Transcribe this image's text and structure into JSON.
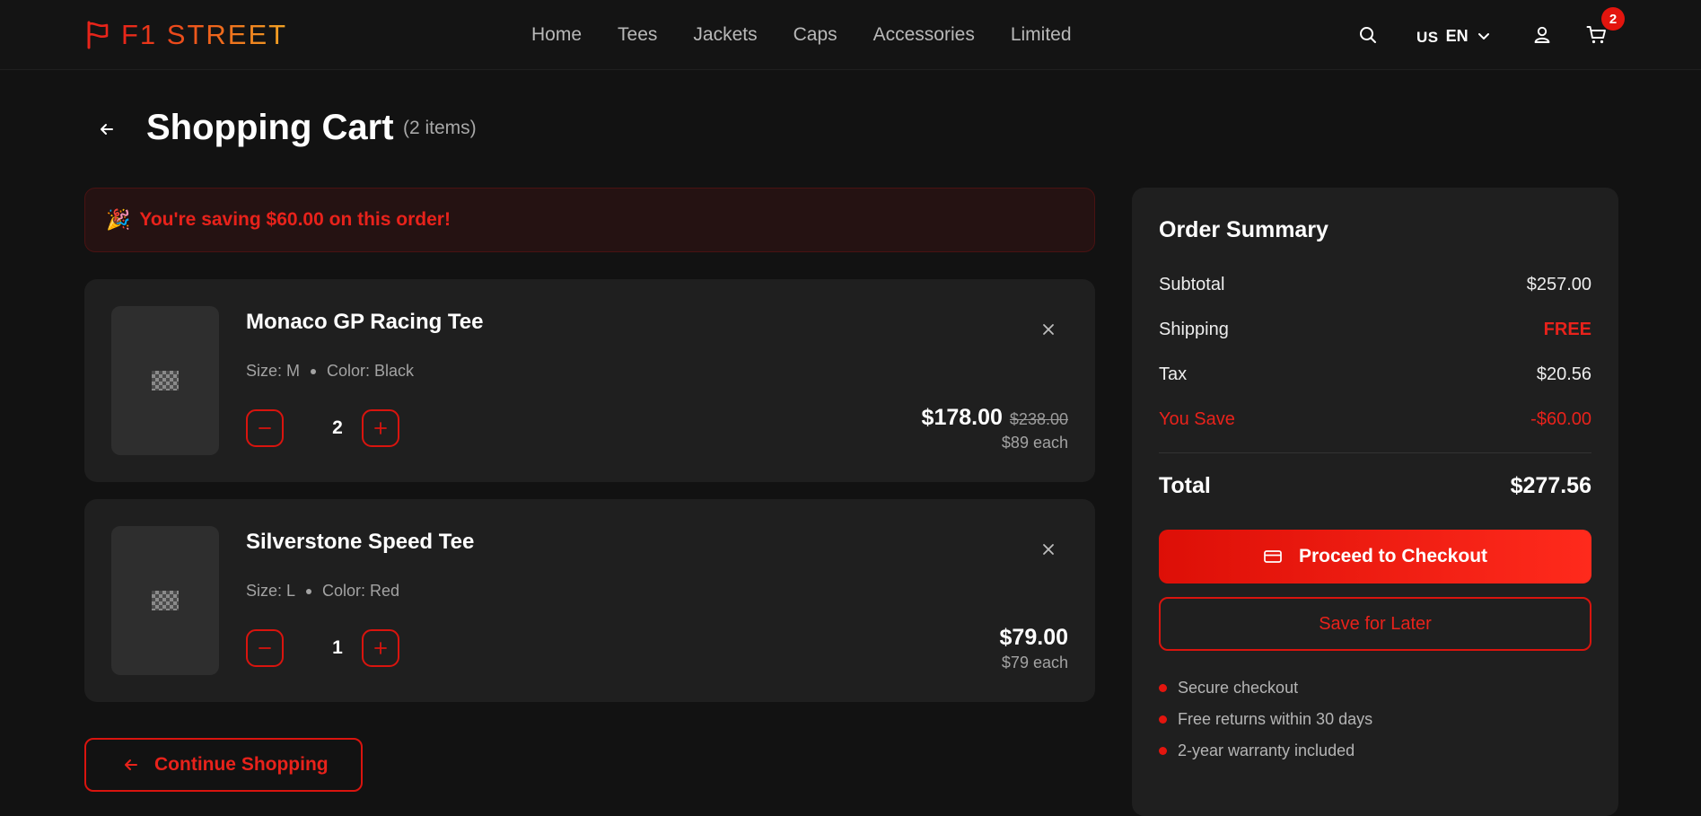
{
  "header": {
    "logo_text": "F1 STREET",
    "nav": [
      "Home",
      "Tees",
      "Jackets",
      "Caps",
      "Accessories",
      "Limited"
    ],
    "lang_flag": "US",
    "lang_code": "EN",
    "cart_count": "2",
    "icons": [
      "search-icon",
      "chevron-down-icon",
      "user-icon",
      "cart-icon",
      "flag-icon"
    ]
  },
  "page": {
    "title": "Shopping Cart",
    "item_count": "(2 items)"
  },
  "savings_banner": {
    "emoji": "🎉",
    "text": "You're saving $60.00 on this order!"
  },
  "items": [
    {
      "name": "Monaco GP Racing Tee",
      "size": "Size: M",
      "color": "Color: Black",
      "quantity": "2",
      "price": "$178.00",
      "old_price": "$238.00",
      "each": "$89 each"
    },
    {
      "name": "Silverstone Speed Tee",
      "size": "Size: L",
      "color": "Color: Red",
      "quantity": "1",
      "price": "$79.00",
      "old_price": "",
      "each": "$79 each"
    }
  ],
  "continue_label": "Continue Shopping",
  "summary": {
    "title": "Order Summary",
    "subtotal_label": "Subtotal",
    "subtotal_value": "$257.00",
    "shipping_label": "Shipping",
    "shipping_value": "FREE",
    "tax_label": "Tax",
    "tax_value": "$20.56",
    "save_label": "You Save",
    "save_value": "-$60.00",
    "total_label": "Total",
    "total_value": "$277.56",
    "checkout_label": "Proceed to Checkout",
    "save_later_label": "Save for Later",
    "perks": [
      "Secure checkout",
      "Free returns within 30 days",
      "2-year warranty included"
    ]
  },
  "colors": {
    "accent": "#e3150e",
    "background": "#121212",
    "card": "#1f1f1f"
  }
}
